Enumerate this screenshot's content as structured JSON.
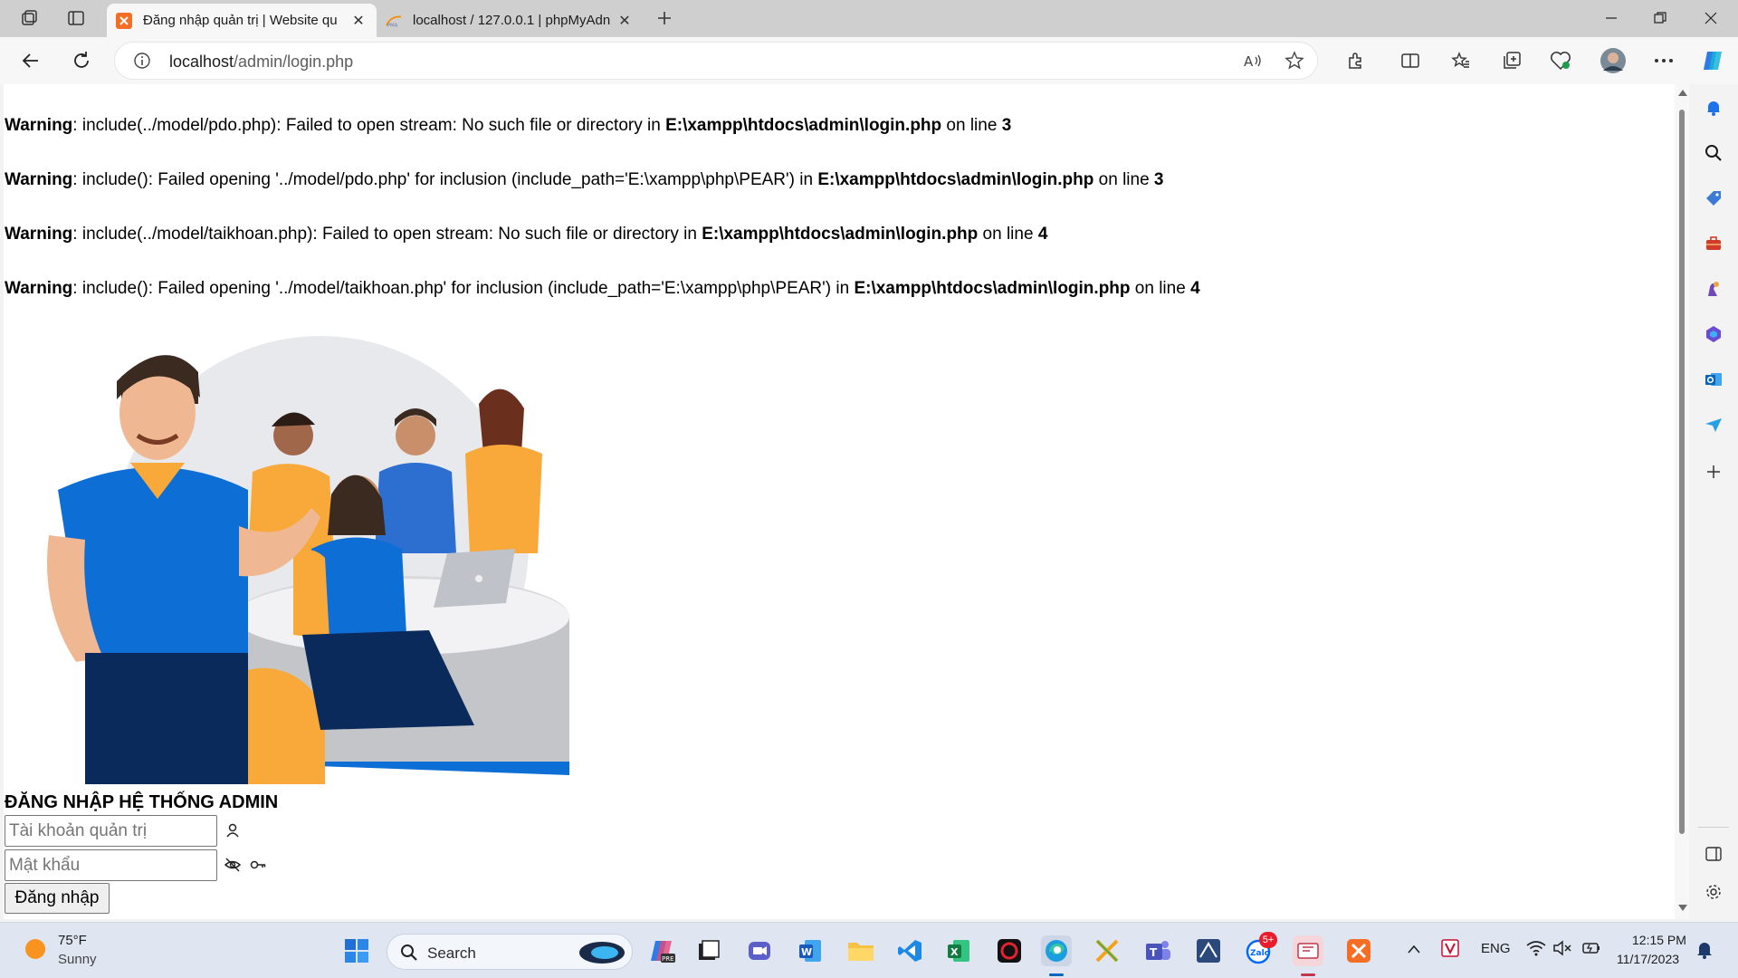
{
  "browser": {
    "tabs": [
      {
        "title": "Đăng nhập quản trị | Website qu",
        "active": true,
        "favicon": "xampp-icon",
        "favicon_color": "#f46f25"
      },
      {
        "title": "localhost / 127.0.0.1 | phpMyAdn",
        "active": false,
        "favicon": "phpmyadmin-icon",
        "favicon_color": "#f29111"
      }
    ],
    "address": {
      "host": "localhost",
      "path": "/admin/login.php"
    }
  },
  "page": {
    "warnings": [
      {
        "label": "Warning",
        "message": ": include(../model/pdo.php): Failed to open stream: No such file or directory in ",
        "file": "E:\\xampp\\htdocs\\admin\\login.php",
        "on_line": " on line ",
        "line": "3"
      },
      {
        "label": "Warning",
        "message": ": include(): Failed opening '../model/pdo.php' for inclusion (include_path='E:\\xampp\\php\\PEAR') in ",
        "file": "E:\\xampp\\htdocs\\admin\\login.php",
        "on_line": " on line ",
        "line": "3"
      },
      {
        "label": "Warning",
        "message": ": include(../model/taikhoan.php): Failed to open stream: No such file or directory in ",
        "file": "E:\\xampp\\htdocs\\admin\\login.php",
        "on_line": " on line ",
        "line": "4"
      },
      {
        "label": "Warning",
        "message": ": include(): Failed opening '../model/taikhoan.php' for inclusion (include_path='E:\\xampp\\php\\PEAR') in ",
        "file": "E:\\xampp\\htdocs\\admin\\login.php",
        "on_line": " on line ",
        "line": "4"
      }
    ],
    "login": {
      "title": "ĐĂNG NHẬP HỆ THỐNG ADMIN",
      "username_placeholder": "Tài khoản quản trị",
      "password_placeholder": "Mật khẩu",
      "submit_label": "Đăng nhập"
    }
  },
  "taskbar": {
    "weather": {
      "temp": "75°F",
      "condition": "Sunny"
    },
    "search_label": "Search",
    "language": "ENG",
    "time": "12:15 PM",
    "date": "11/17/2023",
    "zalo_badge": "5+"
  },
  "colors": {
    "accent_blue": "#0063b1",
    "illustration_blue": "#0d6fd6",
    "illustration_orange": "#f9a93a"
  }
}
